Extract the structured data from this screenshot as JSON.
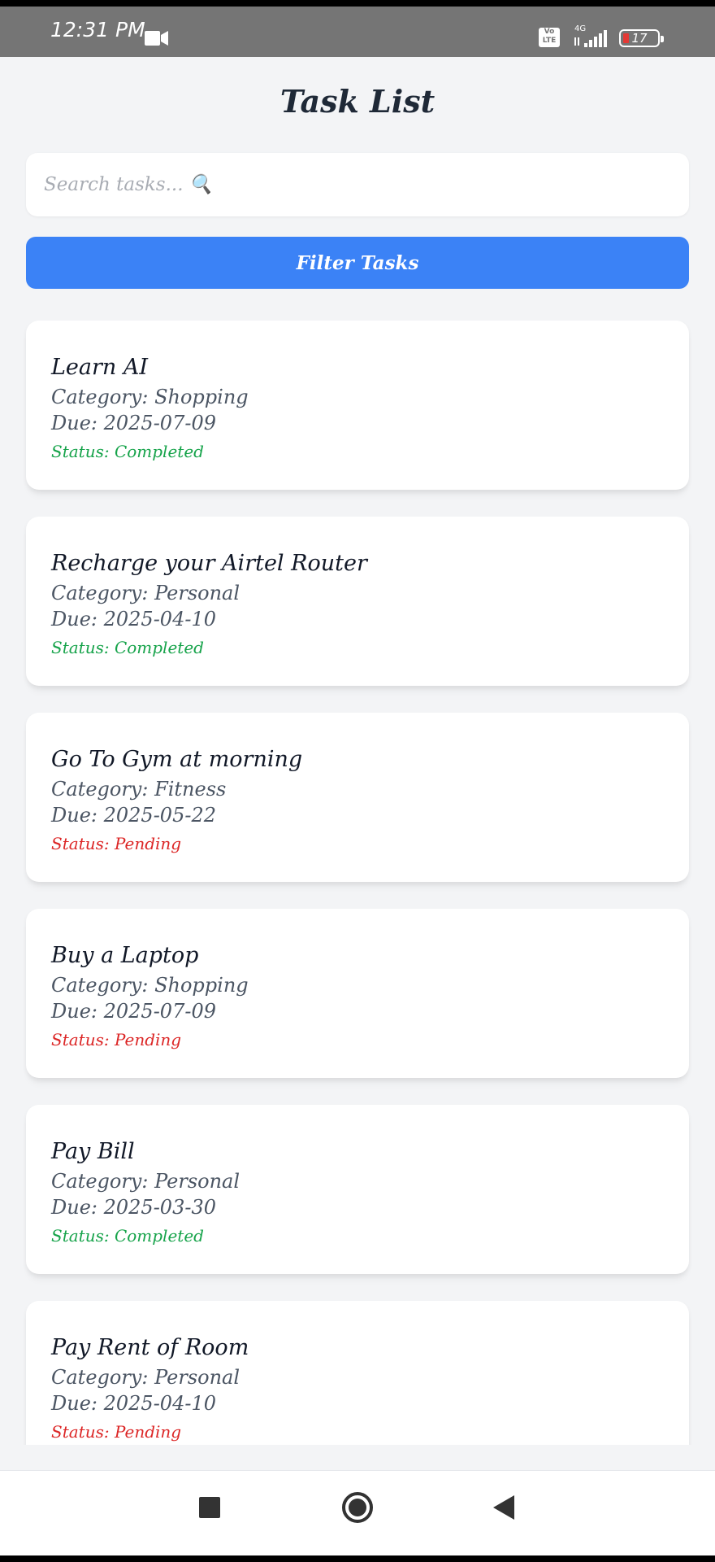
{
  "status_bar": {
    "time": "12:31 PM",
    "network_label": "4G",
    "volte_label": "Vo LTE",
    "battery_level": "17",
    "icons": [
      "video-camera-icon",
      "volte-icon",
      "signal-icon",
      "battery-icon"
    ]
  },
  "header": {
    "title": "Task List"
  },
  "search": {
    "placeholder": "Search tasks... 🔍",
    "value": ""
  },
  "filter_button": {
    "label": "Filter Tasks"
  },
  "tasks": [
    {
      "title": "Learn AI",
      "category": "Category: Shopping",
      "due": "Due: 2025-07-09",
      "status": "Status: Completed",
      "status_type": "completed"
    },
    {
      "title": "Recharge your Airtel Router",
      "category": "Category: Personal",
      "due": "Due: 2025-04-10",
      "status": "Status: Completed",
      "status_type": "completed"
    },
    {
      "title": "Go To Gym at morning",
      "category": "Category: Fitness",
      "due": "Due: 2025-05-22",
      "status": "Status: Pending",
      "status_type": "pending"
    },
    {
      "title": "Buy a Laptop",
      "category": "Category: Shopping",
      "due": "Due: 2025-07-09",
      "status": "Status: Pending",
      "status_type": "pending"
    },
    {
      "title": "Pay Bill",
      "category": "Category: Personal",
      "due": "Due: 2025-03-30",
      "status": "Status: Completed",
      "status_type": "completed"
    },
    {
      "title": "Pay Rent of Room",
      "category": "Category: Personal",
      "due": "Due: 2025-04-10",
      "status": "Status: Pending",
      "status_type": "pending"
    }
  ],
  "colors": {
    "accent": "#3b82f6",
    "completed": "#16a34a",
    "pending": "#dc2626",
    "background": "#f3f4f6"
  },
  "nav_bar": {
    "icons": [
      "recent-apps-icon",
      "home-icon",
      "back-icon"
    ]
  }
}
